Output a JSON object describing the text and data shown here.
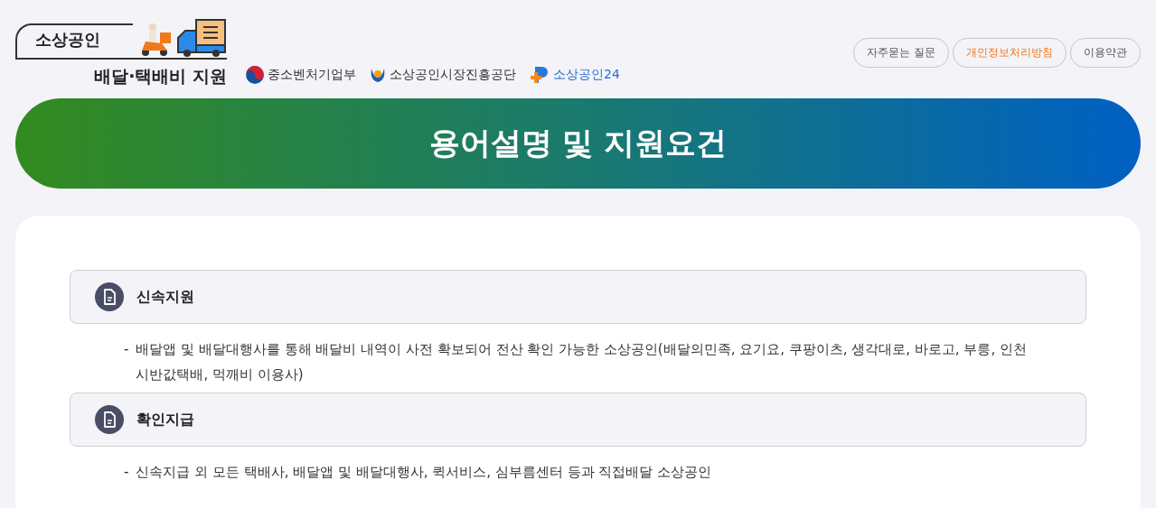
{
  "logo": {
    "badge": "소상공인",
    "title": "배달·택배비 지원"
  },
  "agencies": [
    {
      "name": "중소벤처기업부",
      "kind": "ministry"
    },
    {
      "name": "소상공인시장진흥공단",
      "kind": "semas"
    },
    {
      "name": "소상공인24",
      "kind": "portal"
    }
  ],
  "top_links": [
    {
      "label": "자주묻는 질문",
      "highlighted": false
    },
    {
      "label": "개인정보처리방침",
      "highlighted": true
    },
    {
      "label": "이용약관",
      "highlighted": false
    }
  ],
  "banner": {
    "title": "용어설명 및 지원요건"
  },
  "sections": [
    {
      "heading": "신속지원",
      "items": [
        {
          "bullet": "-",
          "text": "배달앱 및 배달대행사를 통해 배달비 내역이 사전 확보되어 전산 확인 가능한 소상공인(배달의민족, 요기요, 쿠팡이츠, 생각대로, 바로고, 부릉, 인천시반값택배, 먹깨비 이용사)"
        }
      ]
    },
    {
      "heading": "확인지급",
      "items": [
        {
          "bullet": "-",
          "text": "신속지급 외 모든 택배사, 배달앱 및 배달대행사, 퀵서비스, 심부름센터 등과 직접배달 소상공인"
        }
      ]
    }
  ]
}
